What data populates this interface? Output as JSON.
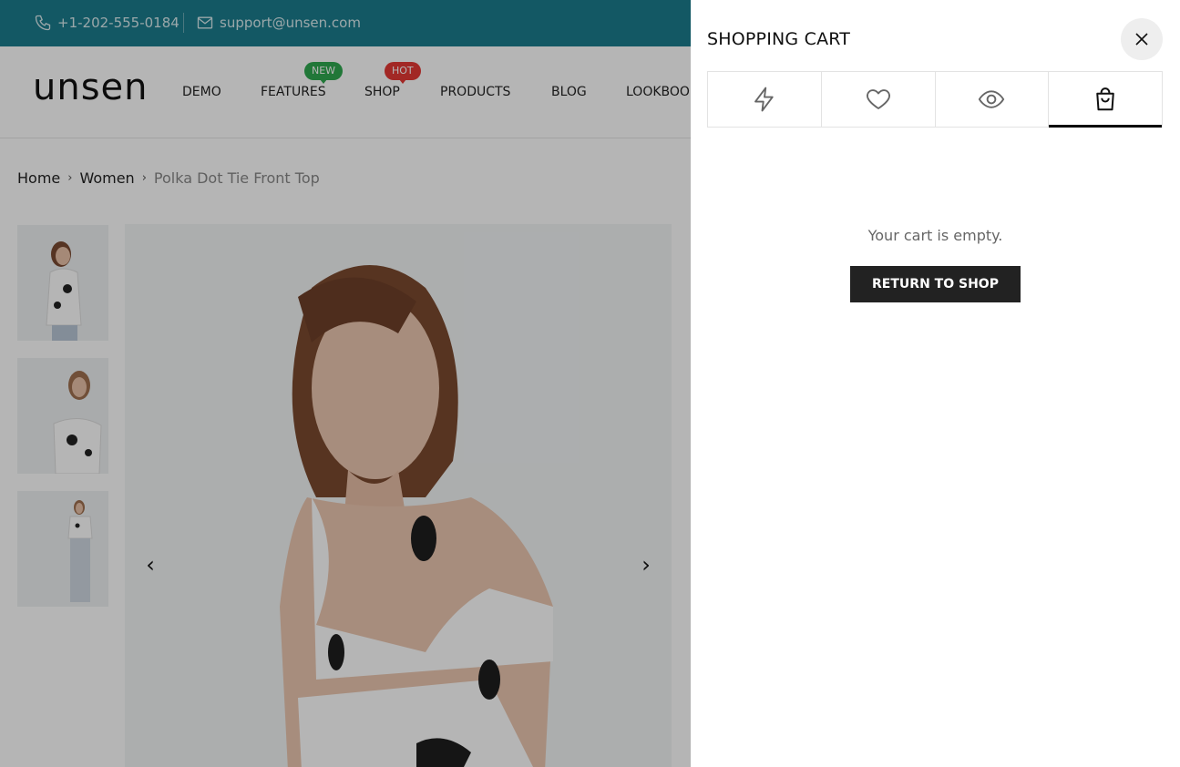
{
  "topbar": {
    "phone": "+1-202-555-0184",
    "email": "support@unsen.com"
  },
  "header": {
    "logo": "unsen",
    "nav": [
      {
        "label": "DEMO"
      },
      {
        "label": "FEATURES",
        "badge": "New",
        "badge_color": "#2fa84f"
      },
      {
        "label": "SHOP",
        "badge": "Hot",
        "badge_color": "#e53935"
      },
      {
        "label": "PRODUCTS"
      },
      {
        "label": "BLOG"
      },
      {
        "label": "LOOKBOOK"
      }
    ]
  },
  "breadcrumb": {
    "items": [
      "Home",
      "Women"
    ],
    "current": "Polka Dot Tie Front Top"
  },
  "gallery": {
    "thumbnails": [
      "thumb-back-view",
      "thumb-front-view",
      "thumb-full-view"
    ],
    "prev_icon": "chevron-left-icon",
    "next_icon": "chevron-right-icon"
  },
  "drawer": {
    "title": "SHOPPING CART",
    "close_icon": "close-icon",
    "tabs": [
      {
        "icon": "lightning-icon",
        "active": false
      },
      {
        "icon": "heart-icon",
        "active": false
      },
      {
        "icon": "eye-icon",
        "active": false
      },
      {
        "icon": "shopping-bag-icon",
        "active": true
      }
    ],
    "empty_message": "Your cart is empty.",
    "return_button": "RETURN TO SHOP"
  },
  "colors": {
    "topbar": "#1b7c8e",
    "button": "#222222",
    "badge_new": "#2fa84f",
    "badge_hot": "#e53935"
  }
}
